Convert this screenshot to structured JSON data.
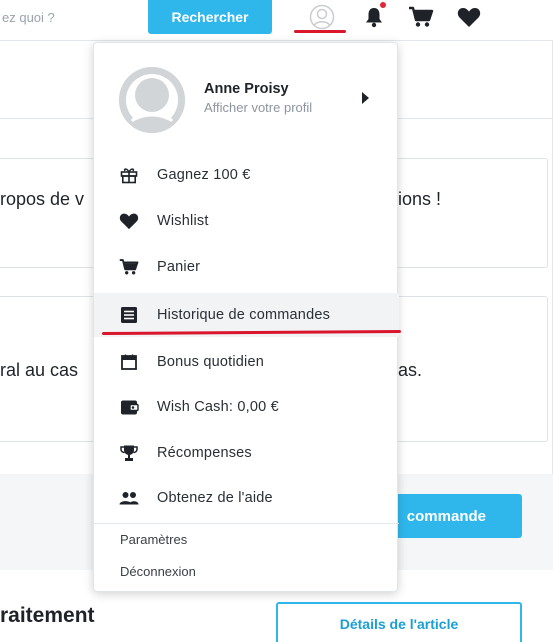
{
  "header": {
    "search_placeholder": "ez quoi ?",
    "search_button": "Rechercher",
    "icons": [
      "user-icon",
      "bell-icon",
      "cart-icon",
      "heart-icon"
    ],
    "accent_color": "#2fb7ec",
    "highlight_color": "#d9162b"
  },
  "background": {
    "card1_text_left": "ropos de v",
    "card1_text_right": "ions !",
    "card2_text_left": "ral au cas",
    "card2_text_right": "as.",
    "order_button": "commande",
    "section_title": "raitement",
    "details_button": "Détails de l'article"
  },
  "menu": {
    "profile": {
      "name": "Anne Proisy",
      "link": "Afficher votre profil"
    },
    "items": [
      {
        "label": "Gagnez 100 €",
        "icon": "gift-icon"
      },
      {
        "label": "Wishlist",
        "icon": "heart-icon"
      },
      {
        "label": "Panier",
        "icon": "cart-icon"
      },
      {
        "label": "Historique de commandes",
        "icon": "order-history-icon",
        "active": true
      },
      {
        "label": "Bonus quotidien",
        "icon": "calendar-icon"
      },
      {
        "label": "Wish Cash: 0,00 €",
        "icon": "wallet-icon"
      },
      {
        "label": "Récompenses",
        "icon": "trophy-icon"
      },
      {
        "label": "Obtenez de l'aide",
        "icon": "people-icon"
      }
    ],
    "settings": "Paramètres",
    "logout": "Déconnexion"
  }
}
